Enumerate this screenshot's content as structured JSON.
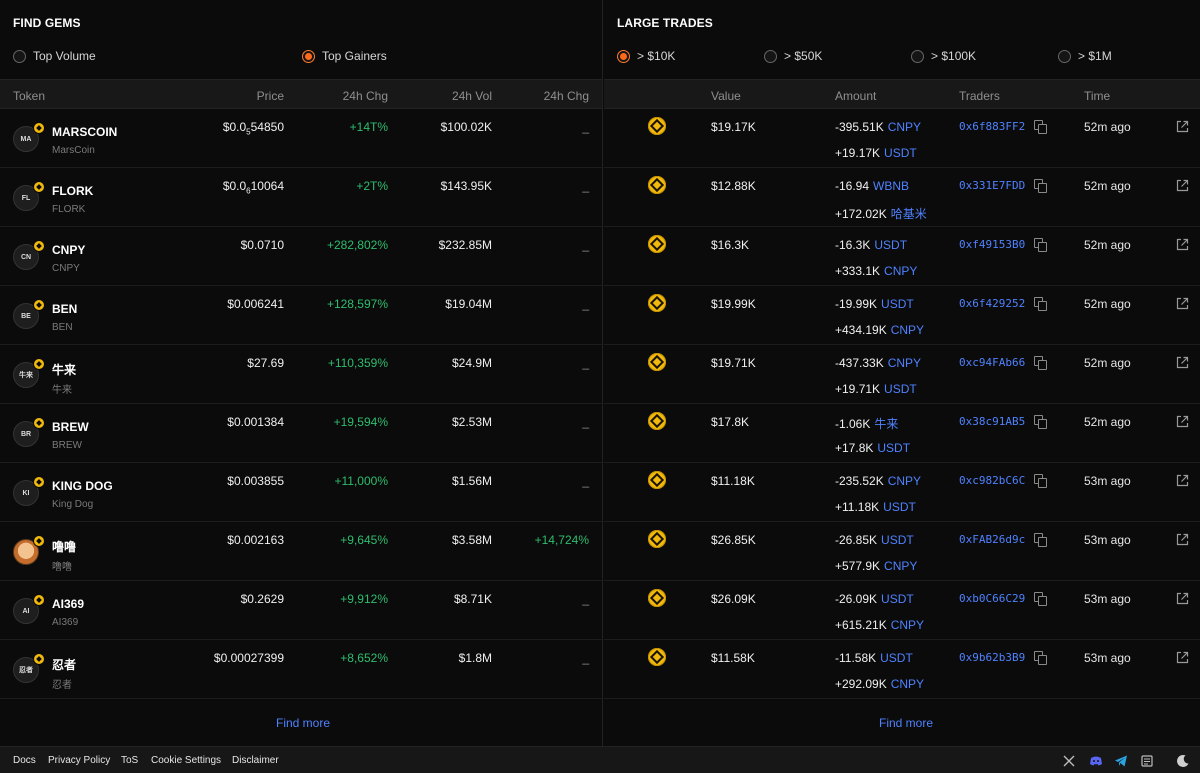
{
  "find_gems": {
    "title": "FIND GEMS",
    "filters": [
      {
        "label": "Top Volume",
        "selected": false
      },
      {
        "label": "Top Gainers",
        "selected": true
      }
    ],
    "columns": [
      "Token",
      "Price",
      "24h Chg",
      "24h Vol",
      "24h Chg"
    ],
    "rows": [
      {
        "avatar": "MA",
        "name": "MARSCOIN",
        "symbol": "MarsCoin",
        "price_pre": "$0.0",
        "price_sub": "5",
        "price_post": "54850",
        "chg": "+14T%",
        "vol": "$100.02K",
        "chg2": "_"
      },
      {
        "avatar": "FL",
        "name": "FLORK",
        "symbol": "FLORK",
        "price_pre": "$0.0",
        "price_sub": "6",
        "price_post": "10064",
        "chg": "+2T%",
        "vol": "$143.95K",
        "chg2": "_"
      },
      {
        "avatar": "CN",
        "name": "CNPY",
        "symbol": "CNPY",
        "price_pre": "$0.0710",
        "price_sub": "",
        "price_post": "",
        "chg": "+282,802%",
        "vol": "$232.85M",
        "chg2": "_"
      },
      {
        "avatar": "BE",
        "name": "BEN",
        "symbol": "BEN",
        "price_pre": "$0.006241",
        "price_sub": "",
        "price_post": "",
        "chg": "+128,597%",
        "vol": "$19.04M",
        "chg2": "_"
      },
      {
        "avatar": "牛来",
        "name": "牛来",
        "symbol": "牛来",
        "price_pre": "$27.69",
        "price_sub": "",
        "price_post": "",
        "chg": "+110,359%",
        "vol": "$24.9M",
        "chg2": "_"
      },
      {
        "avatar": "BR",
        "name": "BREW",
        "symbol": "BREW",
        "price_pre": "$0.001384",
        "price_sub": "",
        "price_post": "",
        "chg": "+19,594%",
        "vol": "$2.53M",
        "chg2": "_"
      },
      {
        "avatar": "KI",
        "name": "KING DOG",
        "symbol": "King Dog",
        "price_pre": "$0.003855",
        "price_sub": "",
        "price_post": "",
        "chg": "+11,000%",
        "vol": "$1.56M",
        "chg2": "_"
      },
      {
        "avatar": "",
        "name": "噜噜",
        "symbol": "噜噜",
        "price_pre": "$0.002163",
        "price_sub": "",
        "price_post": "",
        "chg": "+9,645%",
        "vol": "$3.58M",
        "chg2": "+14,724%"
      },
      {
        "avatar": "AI",
        "name": "AI369",
        "symbol": "AI369",
        "price_pre": "$0.2629",
        "price_sub": "",
        "price_post": "",
        "chg": "+9,912%",
        "vol": "$8.71K",
        "chg2": "_"
      },
      {
        "avatar": "忍者",
        "name": "忍者",
        "symbol": "忍者",
        "price_pre": "$0.00027399",
        "price_sub": "",
        "price_post": "",
        "chg": "+8,652%",
        "vol": "$1.8M",
        "chg2": "_"
      }
    ],
    "find_more": "Find more"
  },
  "large_trades": {
    "title": "LARGE TRADES",
    "filters": [
      {
        "label": "> $10K",
        "selected": true
      },
      {
        "label": "> $50K",
        "selected": false
      },
      {
        "label": "> $100K",
        "selected": false
      },
      {
        "label": "> $1M",
        "selected": false
      }
    ],
    "columns": [
      "Value",
      "Amount",
      "Traders",
      "Time"
    ],
    "rows": [
      {
        "value": "$19.17K",
        "amt1": "-395.51K",
        "tk1": "CNPY",
        "amt2": "+19.17K",
        "tk2": "USDT",
        "trader": "0x6f883FF2",
        "time": "52m ago"
      },
      {
        "value": "$12.88K",
        "amt1": "-16.94",
        "tk1": "WBNB",
        "amt2": "+172.02K",
        "tk2": "哈基米",
        "trader": "0x331E7FDD",
        "time": "52m ago"
      },
      {
        "value": "$16.3K",
        "amt1": "-16.3K",
        "tk1": "USDT",
        "amt2": "+333.1K",
        "tk2": "CNPY",
        "trader": "0xf49153B0",
        "time": "52m ago"
      },
      {
        "value": "$19.99K",
        "amt1": "-19.99K",
        "tk1": "USDT",
        "amt2": "+434.19K",
        "tk2": "CNPY",
        "trader": "0x6f429252",
        "time": "52m ago"
      },
      {
        "value": "$19.71K",
        "amt1": "-437.33K",
        "tk1": "CNPY",
        "amt2": "+19.71K",
        "tk2": "USDT",
        "trader": "0xc94FAb66",
        "time": "52m ago"
      },
      {
        "value": "$17.8K",
        "amt1": "-1.06K",
        "tk1": "牛来",
        "amt2": "+17.8K",
        "tk2": "USDT",
        "trader": "0x38c91AB5",
        "time": "52m ago"
      },
      {
        "value": "$11.18K",
        "amt1": "-235.52K",
        "tk1": "CNPY",
        "amt2": "+11.18K",
        "tk2": "USDT",
        "trader": "0xc982bC6C",
        "time": "53m ago"
      },
      {
        "value": "$26.85K",
        "amt1": "-26.85K",
        "tk1": "USDT",
        "amt2": "+577.9K",
        "tk2": "CNPY",
        "trader": "0xFAB26d9c",
        "time": "53m ago"
      },
      {
        "value": "$26.09K",
        "amt1": "-26.09K",
        "tk1": "USDT",
        "amt2": "+615.21K",
        "tk2": "CNPY",
        "trader": "0xb0C66C29",
        "time": "53m ago"
      },
      {
        "value": "$11.58K",
        "amt1": "-11.58K",
        "tk1": "USDT",
        "amt2": "+292.09K",
        "tk2": "CNPY",
        "trader": "0x9b62b3B9",
        "time": "53m ago"
      }
    ],
    "find_more": "Find more"
  },
  "footer": {
    "links": [
      "Docs",
      "Privacy Policy",
      "ToS",
      "Cookie Settings",
      "Disclaimer"
    ],
    "icons": [
      "x-icon",
      "discord-icon",
      "telegram-icon",
      "docs-icon",
      "moon-icon"
    ]
  },
  "colors": {
    "accent": "#ff6a1a",
    "link": "#4f82ff",
    "positive": "#2ebd6e",
    "background": "#0b0b0b"
  }
}
